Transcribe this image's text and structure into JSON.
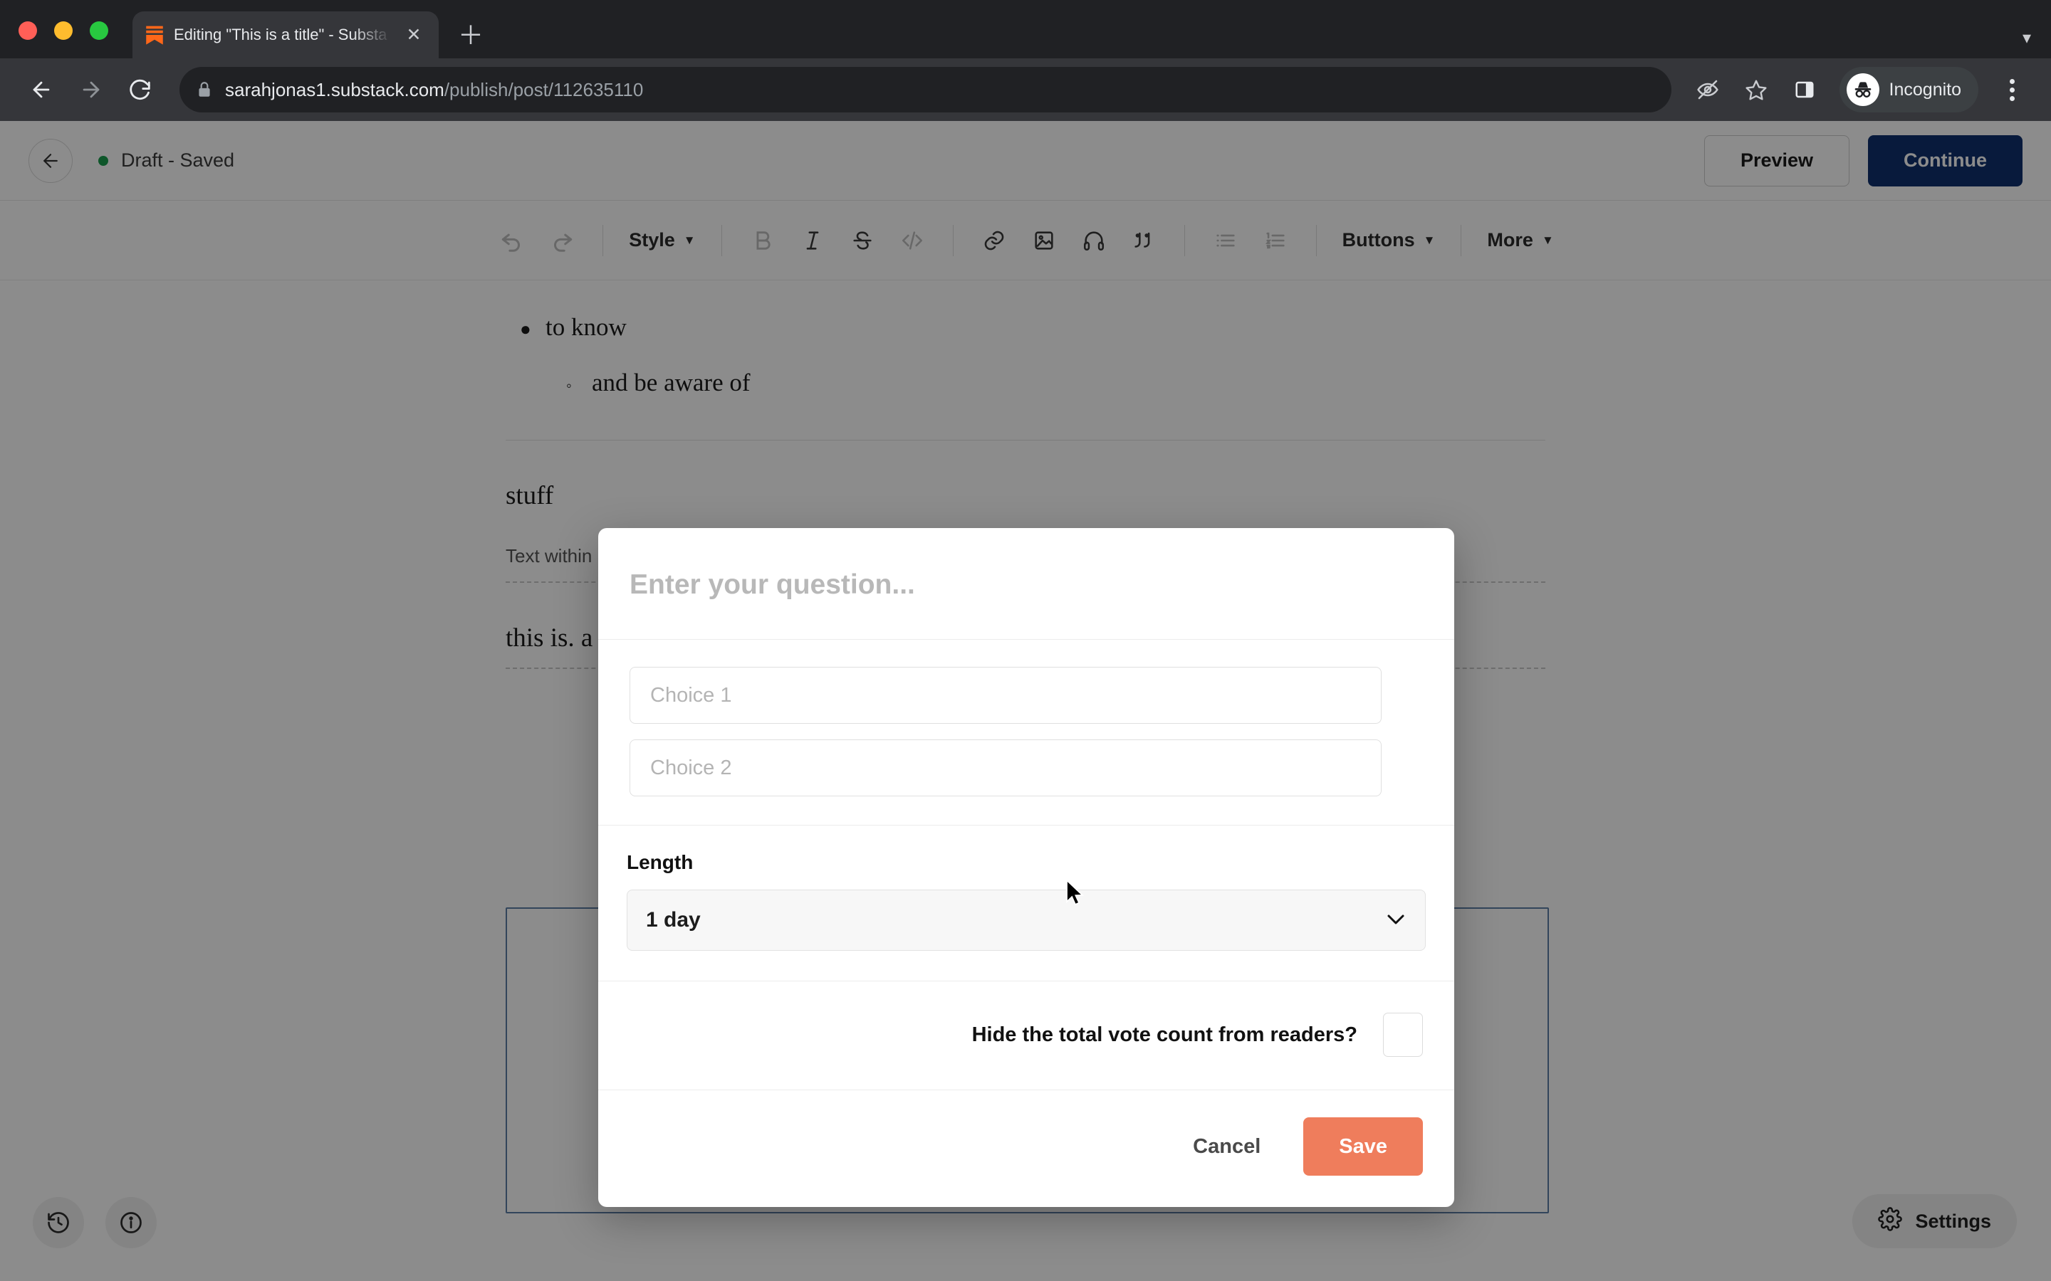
{
  "browser": {
    "tab": {
      "title": "Editing \"This is a title\" - Substa",
      "favicon_icon": "substack-logo-icon",
      "close_icon": "close-icon"
    },
    "new_tab_icon": "plus-icon",
    "tabstrip_menu_icon": "chevron-down-icon",
    "nav": {
      "back_icon": "back-arrow-icon",
      "forward_icon": "forward-arrow-icon",
      "reload_icon": "reload-icon"
    },
    "omnibox": {
      "lock_icon": "lock-icon",
      "url_domain": "sarahjonas1.substack.com",
      "url_path": "/publish/post/112635110"
    },
    "actions": {
      "tracking_protection_icon": "eye-slash-icon",
      "bookmark_icon": "star-icon",
      "side_panel_icon": "side-panel-icon",
      "profile_icon": "incognito-icon",
      "profile_label": "Incognito",
      "menu_icon": "kebab-menu-icon"
    }
  },
  "app": {
    "header": {
      "back_icon": "back-arrow-icon",
      "status_dot_color": "#1a9d4e",
      "status_text": "Draft - Saved",
      "preview_label": "Preview",
      "continue_label": "Continue",
      "continue_color": "#10316e"
    },
    "editor_toolbar": {
      "undo_icon": "undo-icon",
      "redo_icon": "redo-icon",
      "style_label": "Style",
      "style_caret_icon": "caret-down-icon",
      "bold_icon": "bold-icon",
      "italic_icon": "italic-icon",
      "strikethrough_icon": "strikethrough-icon",
      "code_icon": "code-icon",
      "link_icon": "link-icon",
      "image_icon": "image-icon",
      "audio_icon": "headphones-icon",
      "quote_icon": "blockquote-icon",
      "bullet_list_icon": "bullet-list-icon",
      "numbered_list_icon": "numbered-list-icon",
      "buttons_label": "Buttons",
      "buttons_caret_icon": "caret-down-icon",
      "more_label": "More",
      "more_caret_icon": "caret-down-icon"
    },
    "document": {
      "list_item_1": "to know",
      "list_item_2": "and be aware of",
      "paragraph_1": "stuff",
      "caption": "Text within",
      "paragraph_2": "this is. a"
    },
    "footer": {
      "history_icon": "history-clock-icon",
      "info_icon": "info-circle-icon",
      "settings_icon": "gear-icon",
      "settings_label": "Settings"
    }
  },
  "modal": {
    "name": "poll-editor-dialog",
    "question_placeholder": "Enter your question...",
    "choices": [
      {
        "placeholder": "Choice 1"
      },
      {
        "placeholder": "Choice 2"
      }
    ],
    "length": {
      "label": "Length",
      "selected": "1 day",
      "caret_icon": "chevron-down-icon"
    },
    "hide_votes": {
      "label": "Hide the total vote count from readers?",
      "checked": false
    },
    "cancel_label": "Cancel",
    "save_label": "Save",
    "save_color": "#ef7d5c"
  }
}
